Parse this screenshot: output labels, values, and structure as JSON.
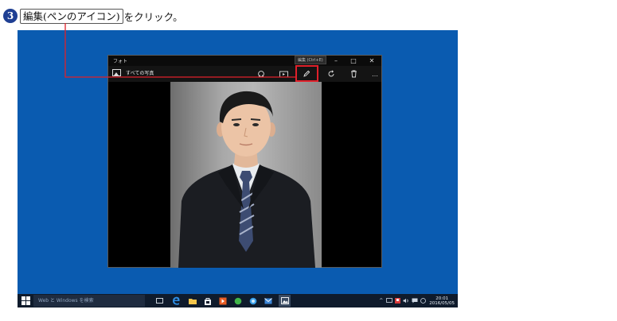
{
  "instruction": {
    "step_number": "3",
    "target_label": "編集(ペンのアイコン)",
    "suffix": "をクリック。"
  },
  "window": {
    "title": "フォト",
    "tooltip": "編集 (Ctrl+E)",
    "back_label": "すべての写真",
    "controls": {
      "minimize": "–",
      "maximize": "□",
      "close": "✕"
    },
    "toolbar_icons": [
      "enhance-icon",
      "slideshow-icon",
      "edit-pen-icon",
      "rotate-icon",
      "delete-icon",
      "more-icon"
    ],
    "more_label": "…"
  },
  "taskbar": {
    "search_placeholder": "Web と Windows を検索",
    "clock_time": "20:01",
    "clock_date": "2016/05/05",
    "apps": [
      "task-view-icon",
      "edge-icon",
      "file-explorer-icon",
      "store-icon",
      "media-icon",
      "app-green-icon",
      "app-blue-icon",
      "mail-icon",
      "photos-icon"
    ]
  },
  "colors": {
    "desktop": "#0a5bb0",
    "taskbar": "#0f1b2c",
    "highlight": "#e0202a",
    "step_badge": "#1f3f93"
  }
}
